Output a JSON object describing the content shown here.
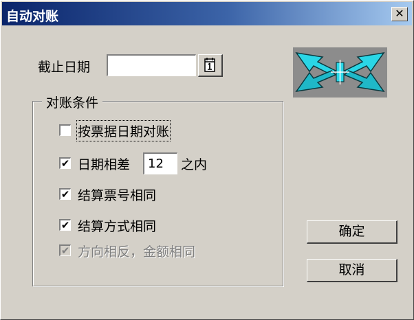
{
  "window": {
    "title": "自动对账",
    "close_glyph": "✕"
  },
  "cutoff": {
    "label": "截止日期",
    "value": "",
    "calendar_icon": "calendar-icon"
  },
  "illustration": {
    "icon": "four-arrows-reconcile-icon",
    "color": "#2ad6e6"
  },
  "conditions": {
    "legend": "对账条件",
    "by_bill_date": {
      "label": "按票据日期对账",
      "checked": false
    },
    "date_diff": {
      "label_before": "日期相差",
      "value": "12",
      "label_after": "之内",
      "checked": true
    },
    "same_bill_no": {
      "label": "结算票号相同",
      "checked": true
    },
    "same_method": {
      "label": "结算方式相同",
      "checked": true
    },
    "opposite_direction": {
      "label": "方向相反，金额相同",
      "checked": true,
      "disabled": true
    }
  },
  "buttons": {
    "ok": "确定",
    "cancel": "取消"
  },
  "check_glyph": "✔"
}
